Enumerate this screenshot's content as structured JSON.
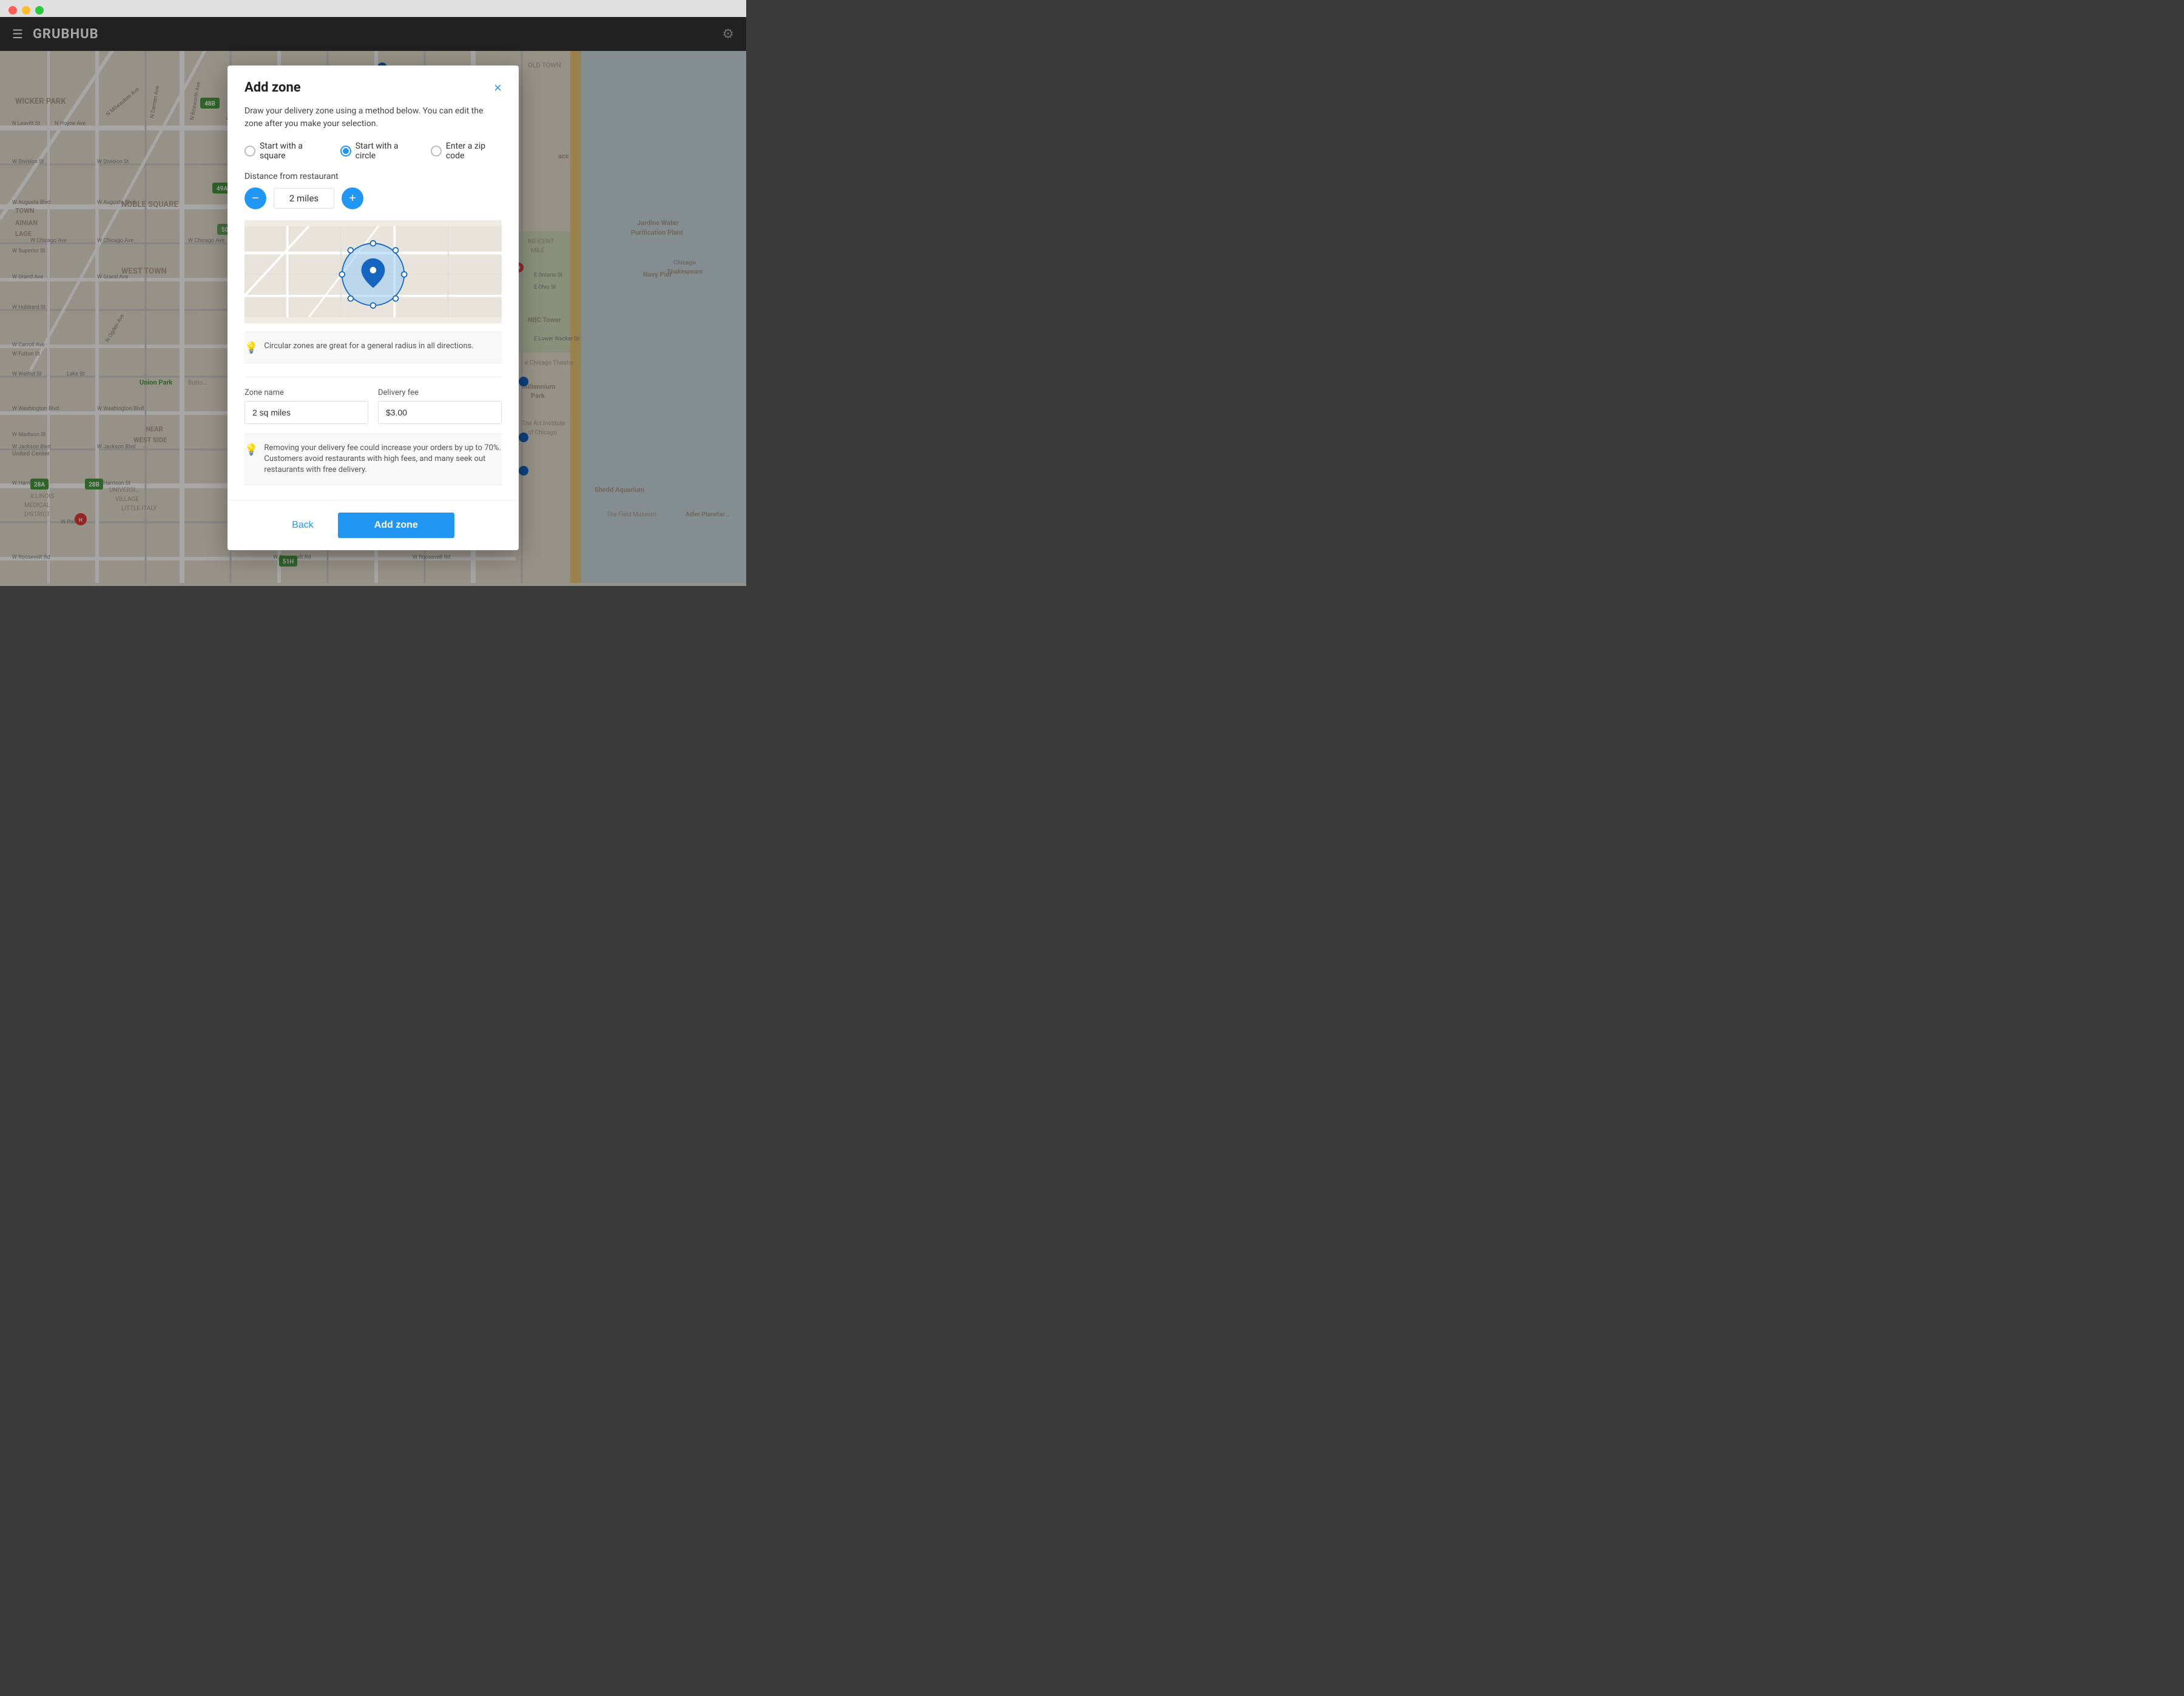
{
  "window": {
    "title": "GrubHub"
  },
  "header": {
    "menu_icon": "☰",
    "title": "GRUBHUB",
    "settings_icon": "⚙"
  },
  "modal": {
    "title": "Add zone",
    "description": "Draw your delivery zone using a method below. You can edit the zone after you make your selection.",
    "close_label": "×",
    "radio_options": [
      {
        "id": "square",
        "label": "Start with a square",
        "selected": false
      },
      {
        "id": "circle",
        "label": "Start with a circle",
        "selected": true
      },
      {
        "id": "zip",
        "label": "Enter a zip code",
        "selected": false
      }
    ],
    "distance_label": "Distance from restaurant",
    "distance_value": "2 miles",
    "minus_label": "−",
    "plus_label": "+",
    "tip1": "Circular zones are great for a general radius in all directions.",
    "zone_name_label": "Zone name",
    "zone_name_value": "2 sq miles",
    "delivery_fee_label": "Delivery fee",
    "delivery_fee_value": "$3.00",
    "tip2": "Removing your delivery fee could increase your orders by up to 70%. Customers avoid restaurants with high fees, and many seek out restaurants with free delivery.",
    "back_label": "Back",
    "add_label": "Add zone"
  }
}
